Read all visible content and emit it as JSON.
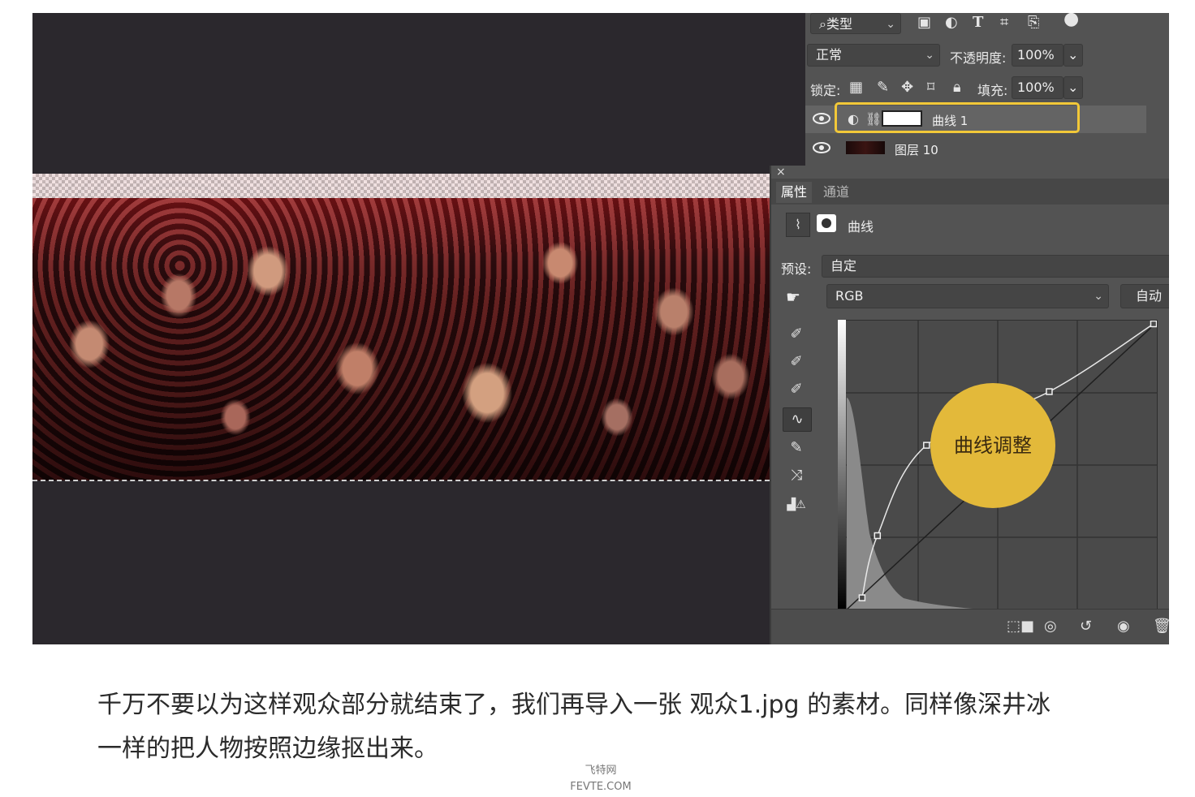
{
  "layers_panel": {
    "filter_kind_label": "类型",
    "blend_mode": "正常",
    "opacity_label": "不透明度:",
    "opacity_value": "100%",
    "lock_label": "锁定:",
    "fill_label": "填充:",
    "fill_value": "100%",
    "layers": [
      {
        "name": "曲线 1",
        "selected": true
      },
      {
        "name": "图层 10",
        "selected": false
      }
    ]
  },
  "properties_panel": {
    "close_glyph": "×",
    "tabs": [
      "属性",
      "通道"
    ],
    "adjustment_title": "曲线",
    "preset_label": "预设:",
    "preset_value": "自定",
    "channel_value": "RGB",
    "auto_button": "自动",
    "callout_text": "曲线调整",
    "curve_points": [
      [
        0.05,
        0.03
      ],
      [
        0.1,
        0.25
      ],
      [
        0.26,
        0.57
      ],
      [
        0.66,
        0.76
      ],
      [
        1.0,
        1.0
      ]
    ]
  },
  "caption": {
    "line1": "千万不要以为这样观众部分就结束了，我们再导入一张 观众1.jpg 的素材。同样像深井冰",
    "line2": "一样的把人物按照边缘抠出来。"
  },
  "watermark": {
    "line1": "飞特网",
    "line2": "FEVTE.COM"
  },
  "colors": {
    "highlight": "#f2c838",
    "callout": "#e3b93a",
    "panel": "#535353",
    "canvas": "#2b282d"
  }
}
